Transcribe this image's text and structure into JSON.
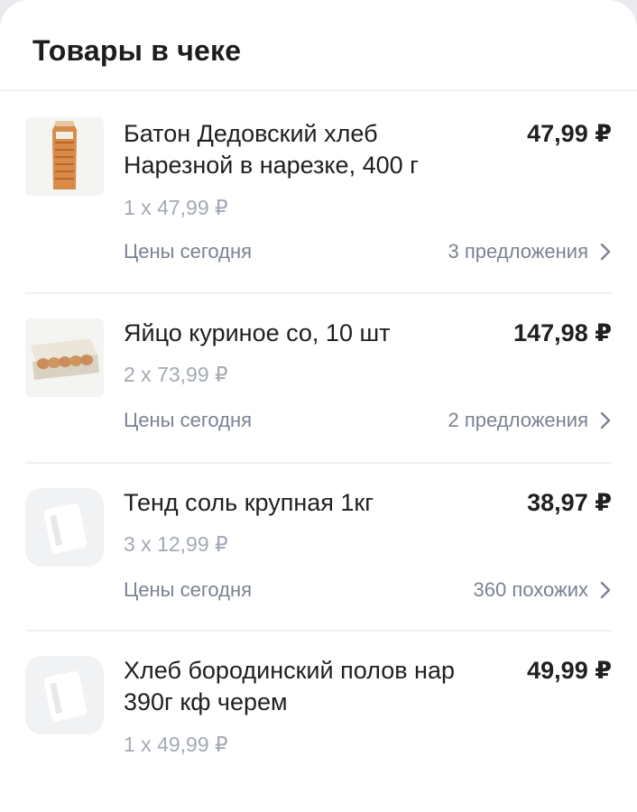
{
  "header": {
    "title": "Товары в чеке"
  },
  "items": [
    {
      "name_line1": "Батон Дедовский хлеб",
      "name_line2": "Нарезной в нарезке, 400 г",
      "price": "47,99 ₽",
      "qty": "1 x 47,99 ₽",
      "today_label": "Цены сегодня",
      "offers": "3 предложения",
      "image": "bread-loaf-image"
    },
    {
      "name_line1": "Яйцо куриное со, 10 шт",
      "name_line2": "",
      "price": "147,98 ₽",
      "qty": "2 x 73,99 ₽",
      "today_label": "Цены сегодня",
      "offers": "2 предложения",
      "image": "egg-carton-image"
    },
    {
      "name_line1": "Тенд соль крупная 1кг",
      "name_line2": "",
      "price": "38,97 ₽",
      "qty": "3 x 12,99 ₽",
      "today_label": "Цены сегодня",
      "offers": "360 похожих",
      "image": "product-placeholder-icon"
    },
    {
      "name_line1": "Хлеб бородинский полов нар",
      "name_line2": "390г кф черем",
      "price": "49,99 ₽",
      "qty": "1 x 49,99 ₽",
      "image": "product-placeholder-icon"
    }
  ],
  "colors": {
    "text_primary": "#21201f",
    "text_secondary": "#7a8391",
    "text_muted": "#a3aab4",
    "divider": "#eef0f2"
  }
}
